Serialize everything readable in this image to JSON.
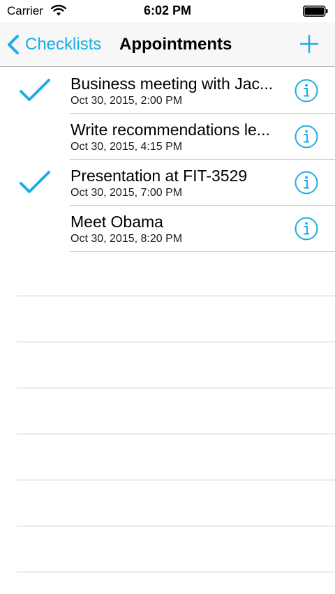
{
  "status_bar": {
    "carrier": "Carrier",
    "time": "6:02 PM"
  },
  "nav": {
    "back_label": "Checklists",
    "title": "Appointments"
  },
  "colors": {
    "accent": "#1aaee3"
  },
  "items": [
    {
      "title": "Business meeting with Jac...",
      "date": "Oct 30, 2015, 2:00 PM",
      "checked": true
    },
    {
      "title": "Write recommendations le...",
      "date": "Oct 30, 2015, 4:15 PM",
      "checked": false
    },
    {
      "title": "Presentation at FIT-3529",
      "date": "Oct 30, 2015, 7:00 PM",
      "checked": true
    },
    {
      "title": "Meet Obama",
      "date": "Oct 30, 2015, 8:20 PM",
      "checked": false
    }
  ]
}
